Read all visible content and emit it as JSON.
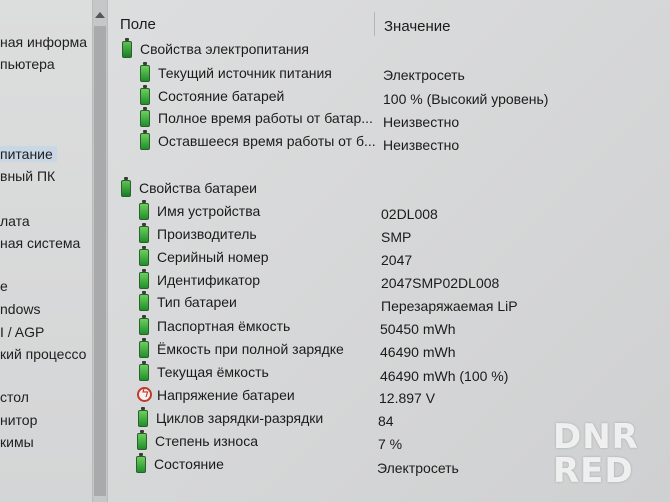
{
  "tree": {
    "items": [
      {
        "label": "ная информа",
        "selected": false
      },
      {
        "label": "пьютера",
        "selected": false
      },
      {
        "label": "питание",
        "selected": true
      },
      {
        "label": "вный ПК",
        "selected": false
      },
      {
        "label": "лата",
        "selected": false
      },
      {
        "label": "ная система",
        "selected": false
      },
      {
        "label": "e",
        "selected": false
      },
      {
        "label": "ndows",
        "selected": false
      },
      {
        "label": "I / AGP",
        "selected": false
      },
      {
        "label": "кий процессо",
        "selected": false
      },
      {
        "label": "стол",
        "selected": false
      },
      {
        "label": "нитор",
        "selected": false
      },
      {
        "label": "кимы",
        "selected": false
      }
    ]
  },
  "header": {
    "field": "Поле",
    "value": "Значение"
  },
  "groups": [
    {
      "title": "Свойства электропитания",
      "rows": [
        {
          "label": "Текущий источник питания",
          "value": "Электросеть",
          "icon": "battery-icon"
        },
        {
          "label": "Состояние батарей",
          "value": "100 % (Высокий уровень)",
          "icon": "battery-icon"
        },
        {
          "label": "Полное время работы от батар...",
          "value": "Неизвестно",
          "icon": "battery-icon"
        },
        {
          "label": "Оставшееся время работы от б...",
          "value": "Неизвестно",
          "icon": "battery-icon"
        }
      ]
    },
    {
      "title": "Свойства батареи",
      "rows": [
        {
          "label": "Имя устройства",
          "value": "02DL008",
          "icon": "battery-icon"
        },
        {
          "label": "Производитель",
          "value": "SMP",
          "icon": "battery-icon"
        },
        {
          "label": "Серийный номер",
          "value": "2047",
          "icon": "battery-icon"
        },
        {
          "label": "Идентификатор",
          "value": "2047SMP02DL008",
          "icon": "battery-icon"
        },
        {
          "label": "Тип батареи",
          "value": "Перезаряжаемая LiP",
          "icon": "battery-icon"
        },
        {
          "label": "Паспортная ёмкость",
          "value": "50450 mWh",
          "icon": "battery-icon"
        },
        {
          "label": "Ёмкость при полной зарядке",
          "value": "46490 mWh",
          "icon": "battery-icon"
        },
        {
          "label": "Текущая ёмкость",
          "value": "46490 mWh  (100 %)",
          "icon": "battery-icon"
        },
        {
          "label": "Напряжение батареи",
          "value": "12.897 V",
          "icon": "voltage-icon"
        },
        {
          "label": "Циклов зарядки-разрядки",
          "value": "84",
          "icon": "battery-icon"
        },
        {
          "label": "Степень износа",
          "value": "7 %",
          "icon": "battery-icon"
        },
        {
          "label": "Состояние",
          "value": "Электросеть",
          "icon": "battery-icon"
        }
      ]
    }
  ],
  "watermark": {
    "line1": "DNR",
    "line2": "RED"
  }
}
